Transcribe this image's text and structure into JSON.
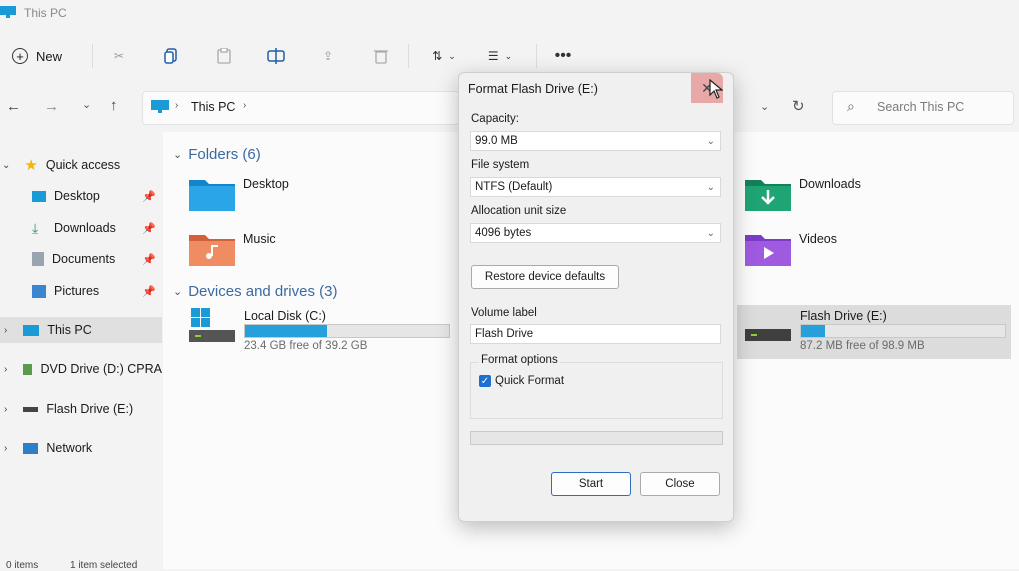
{
  "window": {
    "title": "This PC"
  },
  "toolbar": {
    "new_label": "New"
  },
  "address": {
    "breadcrumb": "This PC",
    "search_placeholder": "Search This PC"
  },
  "sidebar": {
    "items": [
      {
        "label": "Quick access"
      },
      {
        "label": "Desktop"
      },
      {
        "label": "Downloads"
      },
      {
        "label": "Documents"
      },
      {
        "label": "Pictures"
      },
      {
        "label": "This PC"
      },
      {
        "label": "DVD Drive (D:) CPRA"
      },
      {
        "label": "Flash Drive (E:)"
      },
      {
        "label": "Network"
      }
    ]
  },
  "main": {
    "folders_header": "Folders (6)",
    "folders": [
      {
        "name": "Desktop"
      },
      {
        "name": "Downloads"
      },
      {
        "name": "Music"
      },
      {
        "name": "Videos"
      }
    ],
    "drives_header": "Devices and drives (3)",
    "drives": [
      {
        "name": "Local Disk (C:)",
        "free": "23.4 GB free of 39.2 GB",
        "used_fraction": 0.4
      },
      {
        "name": "Flash Drive (E:)",
        "free": "87.2 MB free of 98.9 MB",
        "used_fraction": 0.12
      }
    ]
  },
  "dialog": {
    "title": "Format Flash Drive (E:)",
    "capacity_label": "Capacity:",
    "capacity_value": "99.0 MB",
    "filesystem_label": "File system",
    "filesystem_value": "NTFS (Default)",
    "alloc_label": "Allocation unit size",
    "alloc_value": "4096 bytes",
    "restore_label": "Restore device defaults",
    "volume_label": "Volume label",
    "volume_value": "Flash Drive",
    "format_options_label": "Format options",
    "quick_format_label": "Quick Format",
    "start_label": "Start",
    "close_label": "Close"
  },
  "statusbar": {
    "items": "0 items",
    "selected": "1 item selected"
  },
  "colors": {
    "accent": "#1f5fa8",
    "drive_bar": "#26a0da",
    "close_hover": "#e8a8a8"
  }
}
